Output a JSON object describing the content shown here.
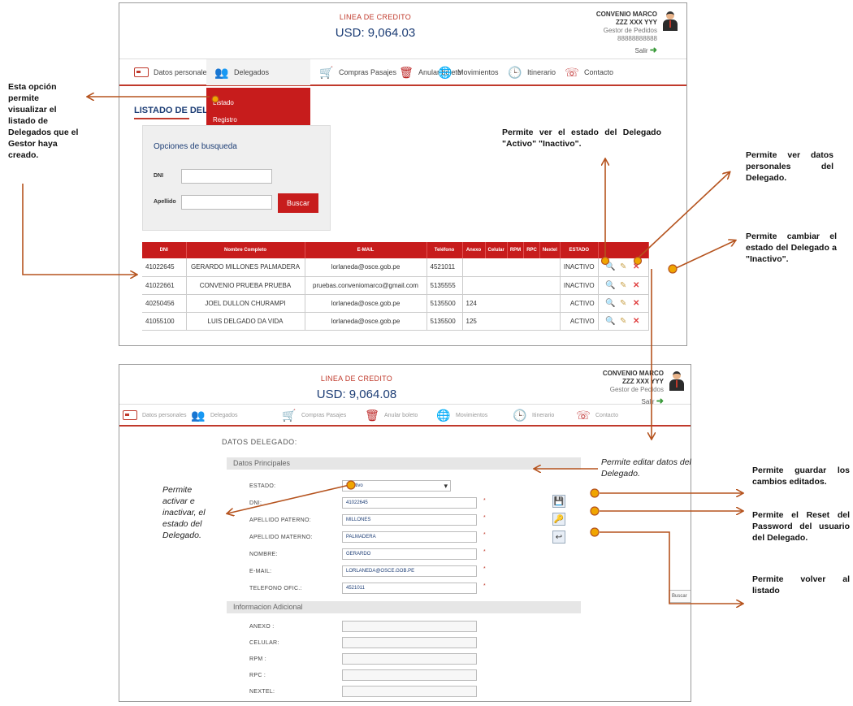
{
  "screen1": {
    "credit_label": "LINEA DE CREDITO",
    "credit_amount": "USD: 9,064.03",
    "user": {
      "company": "CONVENIO MARCO",
      "name": "ZZZ XXX YYY",
      "role": "Gestor de Pedidos",
      "id": "88888888888",
      "logout": "Salir"
    },
    "nav": [
      "Datos personales",
      "Delegados",
      "Compras Pasajes",
      "Anular boleto",
      "Movimientos",
      "Itinerario",
      "Contacto"
    ],
    "dropdown": [
      "Listado",
      "Registro"
    ],
    "list_title": "LISTADO DE DELEGADOS",
    "search": {
      "title": "Opciones de busqueda",
      "dni_label": "DNI",
      "apellido_label": "Apellido",
      "button": "Buscar"
    },
    "table": {
      "headers": [
        "DNI",
        "Nombre Completo",
        "E-MAIL",
        "Teléfono",
        "Anexo",
        "Celular",
        "RPM",
        "RPC",
        "Nextel",
        "ESTADO",
        ""
      ],
      "rows": [
        {
          "dni": "41022645",
          "name": "GERARDO MILLONES PALMADERA",
          "email": "lorlaneda@osce.gob.pe",
          "tel": "4521011",
          "anexo": "",
          "status": "INACTIVO",
          "status_color": "#c71c1c"
        },
        {
          "dni": "41022661",
          "name": "CONVENIO PRUEBA PRUEBA",
          "email": "pruebas.conveniomarco@gmail.com",
          "tel": "5135555",
          "anexo": "",
          "status": "INACTIVO",
          "status_color": "#c71c1c"
        },
        {
          "dni": "40250456",
          "name": "JOEL DULLON CHURAMPI",
          "email": "lorlaneda@osce.gob.pe",
          "tel": "5135500",
          "anexo": "124",
          "status": "ACTIVO",
          "status_color": "#1c3d75"
        },
        {
          "dni": "41055100",
          "name": "LUIS DELGADO DA VIDA",
          "email": "lorlaneda@osce.gob.pe",
          "tel": "5135500",
          "anexo": "125",
          "status": "ACTIVO",
          "status_color": "#1c3d75"
        }
      ]
    }
  },
  "screen2": {
    "credit_label": "LINEA DE CREDITO",
    "credit_amount": "USD: 9,064.08",
    "user": {
      "company": "CONVENIO MARCO",
      "name": "ZZZ XXX YYY",
      "role": "Gestor de Pedidos",
      "logout": "Salir"
    },
    "nav": [
      "Datos personales",
      "Delegados",
      "Compras Pasajes",
      "Anular boleto",
      "Movimientos",
      "Itinerario",
      "Contacto"
    ],
    "form_title": "DATOS DELEGADO:",
    "section_main": "Datos Principales",
    "section_extra": "Informacion Adicional",
    "fields": [
      {
        "label": "ESTADO:",
        "value": "Inactivo"
      },
      {
        "label": "DNI:",
        "value": "41022645"
      },
      {
        "label": "APELLIDO PATERNO:",
        "value": "MILLONES"
      },
      {
        "label": "APELLIDO MATERNO:",
        "value": "PALMADERA"
      },
      {
        "label": "NOMBRE:",
        "value": "GERARDO"
      },
      {
        "label": "E-MAIL:",
        "value": "LORLANEDA@OSCE.GOB.PE"
      },
      {
        "label": "TELEFONO OFIC.:",
        "value": "4521011"
      }
    ],
    "extra_fields": [
      {
        "label": "ANEXO :",
        "value": ""
      },
      {
        "label": "CELULAR:",
        "value": ""
      },
      {
        "label": "RPM :",
        "value": ""
      },
      {
        "label": "RPC :",
        "value": ""
      },
      {
        "label": "NEXTEL:",
        "value": ""
      }
    ],
    "side_cut": "Buscar"
  },
  "annotations": {
    "listado": "Esta opción permite visualizar el listado de Delegados que el Gestor haya creado.",
    "estado_view": "Permite ver el estado del Delegado \"Activo\" \"Inactivo\".",
    "datos_view": "Permite ver datos personales del Delegado.",
    "cambiar": "Permite cambiar el estado del Delegado a \"Inactivo\".",
    "editar": "Permite editar datos del Delegado.",
    "activar": "Permite activar e inactivar, el estado del Delegado.",
    "guardar": "Permite guardar los cambios editados.",
    "reset": "Permite el Reset del Password del usuario del Delegado.",
    "volver": "Permite volver al listado"
  },
  "colors": {
    "accent": "#c71c1c",
    "navy": "#1c3d75",
    "arrow": "#b5531e",
    "marker": "#f0a500"
  }
}
